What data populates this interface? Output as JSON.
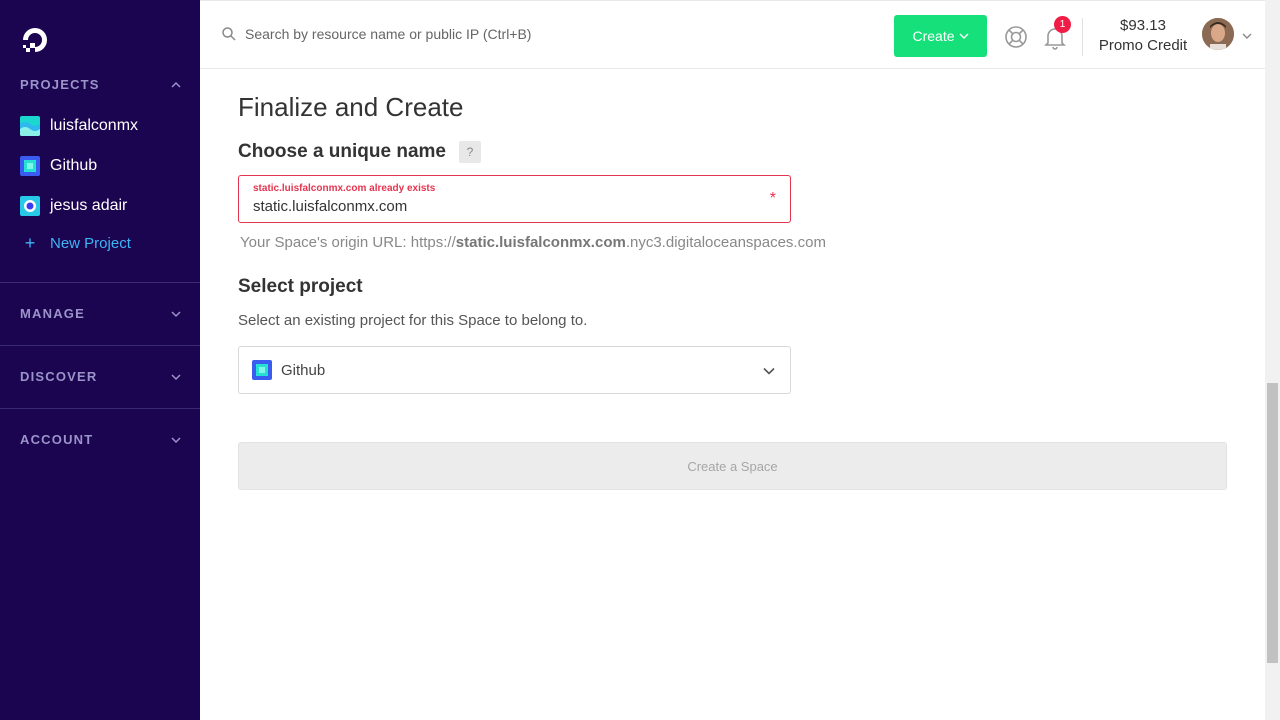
{
  "sidebar": {
    "logo_icon": "digitalocean-logo-icon",
    "sections": {
      "projects": "PROJECTS",
      "manage": "MANAGE",
      "discover": "DISCOVER",
      "account": "ACCOUNT"
    },
    "projects": [
      {
        "label": "luisfalconmx",
        "icon": "project-waves-icon"
      },
      {
        "label": "Github",
        "icon": "project-square-icon"
      },
      {
        "label": "jesus adair",
        "icon": "project-circle-icon"
      }
    ],
    "new_project_label": "New Project"
  },
  "topbar": {
    "search_placeholder": "Search by resource name or public IP (Ctrl+B)",
    "create_label": "Create",
    "notifications_count": "1",
    "credit_amount": "$93.13",
    "credit_label": "Promo Credit"
  },
  "main": {
    "title": "Finalize and Create",
    "name_heading": "Choose a unique name",
    "help_mark": "?",
    "name_error": "static.luisfalconmx.com already exists",
    "name_value": "static.luisfalconmx.com",
    "required_mark": "*",
    "origin_prefix": "Your Space's origin URL: https://",
    "origin_name": "static.luisfalconmx.com",
    "origin_suffix": ".nyc3.digitaloceanspaces.com",
    "project_heading": "Select project",
    "project_desc": "Select an existing project for this Space to belong to.",
    "project_selected": "Github",
    "submit_label": "Create a Space"
  },
  "colors": {
    "sidebar_bg": "#1b0450",
    "accent_green": "#15e07a",
    "error_red": "#e5344f",
    "link_blue": "#3db5f5"
  }
}
